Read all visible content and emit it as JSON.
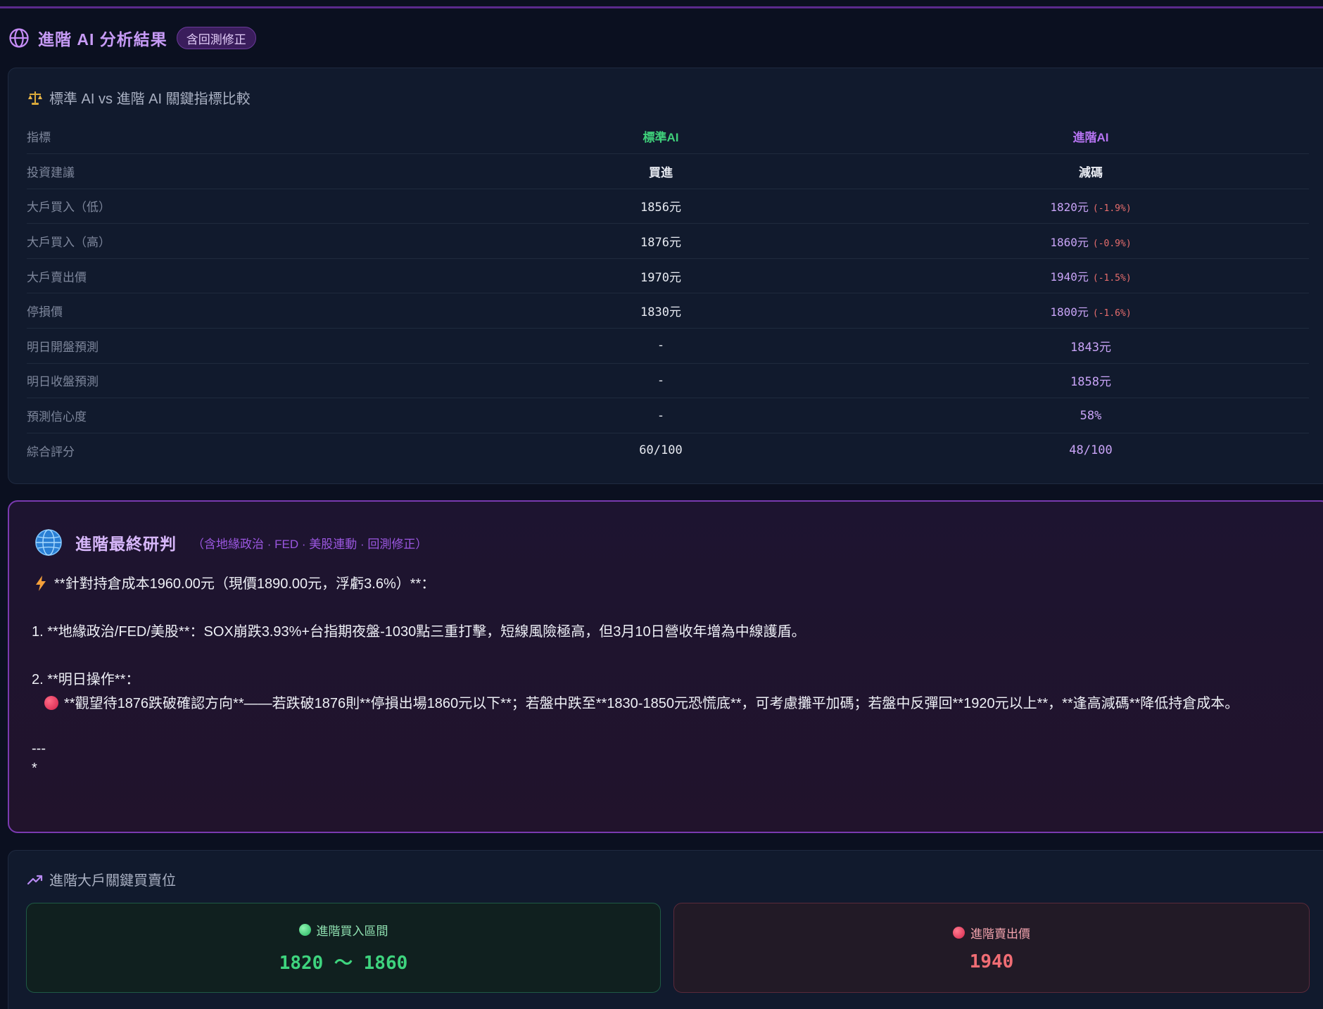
{
  "header": {
    "title": "進階 AI 分析結果",
    "badge": "含回測修正"
  },
  "comparison": {
    "title": "標準 AI vs 進階 AI 關鍵指標比較",
    "columns": [
      "指標",
      "標準AI",
      "進階AI"
    ],
    "rows": [
      {
        "label": "投資建議",
        "standard": "買進",
        "advanced": "減碼",
        "diff": ""
      },
      {
        "label": "大戶買入（低）",
        "standard": "1856元",
        "advanced": "1820元",
        "diff": "(-1.9%)"
      },
      {
        "label": "大戶買入（高）",
        "standard": "1876元",
        "advanced": "1860元",
        "diff": "(-0.9%)"
      },
      {
        "label": "大戶賣出價",
        "standard": "1970元",
        "advanced": "1940元",
        "diff": "(-1.5%)"
      },
      {
        "label": "停損價",
        "standard": "1830元",
        "advanced": "1800元",
        "diff": "(-1.6%)"
      },
      {
        "label": "明日開盤預測",
        "standard": "-",
        "advanced": "1843元",
        "diff": ""
      },
      {
        "label": "明日收盤預測",
        "standard": "-",
        "advanced": "1858元",
        "diff": ""
      },
      {
        "label": "預測信心度",
        "standard": "-",
        "advanced": "58%",
        "diff": ""
      },
      {
        "label": "綜合評分",
        "standard": "60/100",
        "advanced": "48/100",
        "diff": ""
      }
    ]
  },
  "verdict": {
    "title": "進階最終研判",
    "subtitle": "（含地緣政治 · FED · 美股連動 · 回測修正）",
    "line1": "**針對持倉成本1960.00元（現價1890.00元，浮虧3.6%）**：",
    "line2": "1. **地緣政治/FED/美股**：SOX崩跌3.93%+台指期夜盤-1030點三重打擊，短線風險極高，但3月10日營收年增為中線護盾。",
    "line3": "2. **明日操作**：",
    "line4": "**觀望待1876跌破確認方向**——若跌破1876則**停損出場1860元以下**；若盤中跌至**1830-1850元恐慌底**，可考慮攤平加碼；若盤中反彈回**1920元以上**，**逢高減碼**降低持倉成本。",
    "line5": "---",
    "line6": "*"
  },
  "levels": {
    "title": "進階大戶關鍵買賣位",
    "buy_label": "進階買入區間",
    "buy_value": "1820 〜 1860",
    "sell_label": "進階賣出價",
    "sell_value": "1940"
  },
  "colors": {
    "background": "#0b1020",
    "accent_purple": "#b674f2",
    "standard_green": "#3fcf7a",
    "diff_red": "#e66d6d"
  },
  "icons": [
    "globe-icon",
    "scale-icon",
    "earth-globe-icon",
    "lightning-icon",
    "red-circle-icon",
    "trending-up-icon",
    "green-circle-icon"
  ]
}
